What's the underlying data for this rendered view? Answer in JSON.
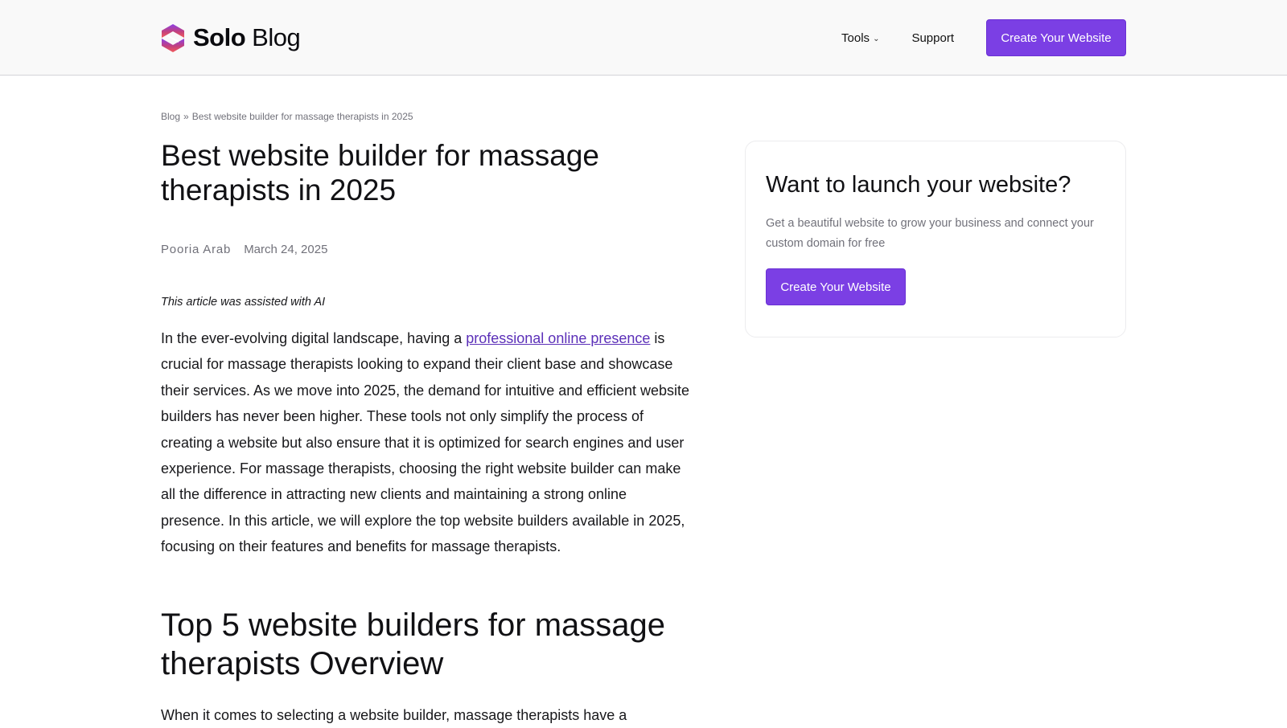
{
  "header": {
    "logo": {
      "brand": "Solo",
      "suffix": "Blog"
    },
    "nav": {
      "tools_label": "Tools",
      "support_label": "Support",
      "cta_label": "Create Your Website"
    }
  },
  "breadcrumb": {
    "root": "Blog",
    "separator": "»",
    "current": "Best website builder for massage therapists in 2025"
  },
  "article": {
    "title": "Best website builder for massage therapists in 2025",
    "author": "Pooria Arab",
    "date": "March 24, 2025",
    "ai_note": "This article was assisted with AI",
    "intro_before_link": "In the ever-evolving digital landscape, having a ",
    "intro_link": "professional online presence",
    "intro_after_link": " is crucial for massage therapists looking to expand their client base and showcase their services. As we move into 2025, the demand for intuitive and efficient website builders has never been higher. These tools not only simplify the process of creating a website but also ensure that it is optimized for search engines and user experience. For massage therapists, choosing the right website builder can make all the difference in attracting new clients and maintaining a strong online presence. In this article, we will explore the top website builders available in 2025, focusing on their features and benefits for massage therapists.",
    "section_title": "Top 5 website builders for massage therapists Overview",
    "section_intro": "When it comes to selecting a website builder, massage therapists have a"
  },
  "sidebar": {
    "title": "Want to launch your website?",
    "text": "Get a beautiful website to grow your business and connect your custom domain for free",
    "cta_label": "Create Your Website"
  },
  "colors": {
    "accent": "#7b3fe4",
    "link": "#5b2fb8",
    "muted": "#71717a"
  },
  "icons": {
    "logo": "solo-logo-icon",
    "tools_dropdown": "chevron-down-icon"
  }
}
